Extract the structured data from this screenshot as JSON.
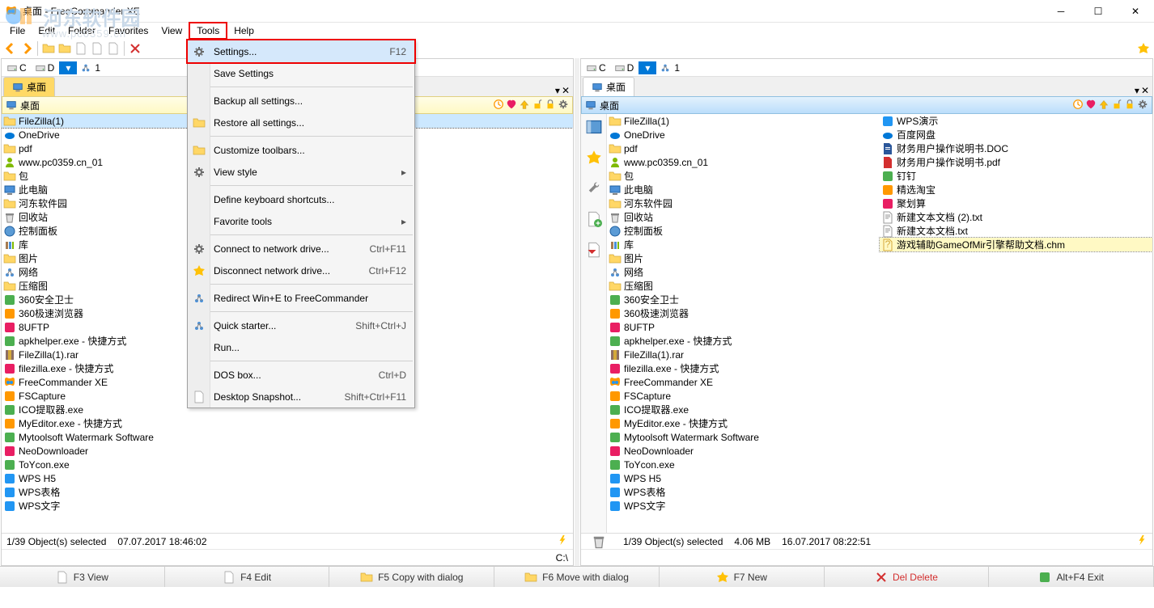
{
  "title": "桌面 - FreeCommander XE",
  "watermark": {
    "text": "河东软件园",
    "sub": "www.pc0359.cn"
  },
  "menubar": [
    "File",
    "Edit",
    "Folder",
    "Favorites",
    "View",
    "Tools",
    "Help"
  ],
  "menubar_highlight_index": 5,
  "dropdown": {
    "groups": [
      [
        {
          "label": "Settings...",
          "shortcut": "F12",
          "highlighted": true
        },
        {
          "label": "Save Settings"
        }
      ],
      [
        {
          "label": "Backup all settings..."
        },
        {
          "label": "Restore all settings..."
        }
      ],
      [
        {
          "label": "Customize toolbars..."
        },
        {
          "label": "View style",
          "submenu": true
        }
      ],
      [
        {
          "label": "Define keyboard shortcuts..."
        },
        {
          "label": "Favorite tools",
          "submenu": true
        }
      ],
      [
        {
          "label": "Connect to network drive...",
          "shortcut": "Ctrl+F11"
        },
        {
          "label": "Disconnect network drive...",
          "shortcut": "Ctrl+F12"
        }
      ],
      [
        {
          "label": "Redirect Win+E to FreeCommander"
        }
      ],
      [
        {
          "label": "Quick starter...",
          "shortcut": "Shift+Ctrl+J"
        },
        {
          "label": "Run..."
        }
      ],
      [
        {
          "label": "DOS box...",
          "shortcut": "Ctrl+D"
        },
        {
          "label": "Desktop Snapshot...",
          "shortcut": "Shift+Ctrl+F11"
        }
      ]
    ]
  },
  "drives": {
    "items": [
      "C",
      "D"
    ],
    "active_index": 1,
    "extra": "1"
  },
  "left": {
    "tab": "桌面",
    "tab_active": true,
    "path": "桌面",
    "status": {
      "selection": "1/39 Object(s) selected",
      "date": "07.07.2017 18:46:02"
    },
    "pathline": "C:\\",
    "files": [
      {
        "name": "FileZilla(1)",
        "type": "folder",
        "selected": "active"
      },
      {
        "name": "OneDrive",
        "type": "cloud"
      },
      {
        "name": "pdf",
        "type": "folder"
      },
      {
        "name": "www.pc0359.cn_01",
        "type": "user"
      },
      {
        "name": "包",
        "type": "folder"
      },
      {
        "name": "此电脑",
        "type": "computer"
      },
      {
        "name": "河东软件园",
        "type": "folder"
      },
      {
        "name": "回收站",
        "type": "recycle"
      },
      {
        "name": "控制面板",
        "type": "control"
      },
      {
        "name": "库",
        "type": "library"
      },
      {
        "name": "图片",
        "type": "folder"
      },
      {
        "name": "网络",
        "type": "network"
      },
      {
        "name": "压缩图",
        "type": "folder"
      },
      {
        "name": "360安全卫士",
        "type": "app360"
      },
      {
        "name": "360极速浏览器",
        "type": "app360b"
      },
      {
        "name": "8UFTP",
        "type": "appftp"
      },
      {
        "name": "apkhelper.exe - 快捷方式",
        "type": "appapk"
      },
      {
        "name": "FileZilla(1).rar",
        "type": "rar"
      },
      {
        "name": "filezilla.exe - 快捷方式",
        "type": "appfz"
      },
      {
        "name": "FreeCommander XE",
        "type": "appfc"
      },
      {
        "name": "FSCapture",
        "type": "appfs"
      },
      {
        "name": "ICO提取器.exe",
        "type": "appico"
      },
      {
        "name": "MyEditor.exe - 快捷方式",
        "type": "appme"
      },
      {
        "name": "Mytoolsoft Watermark Software",
        "type": "appwm"
      },
      {
        "name": "NeoDownloader",
        "type": "appnd"
      },
      {
        "name": "ToYcon.exe",
        "type": "appty"
      },
      {
        "name": "WPS H5",
        "type": "wps"
      },
      {
        "name": "WPS表格",
        "type": "wps"
      },
      {
        "name": "WPS文字",
        "type": "wps"
      }
    ]
  },
  "right": {
    "tab": "桌面",
    "path": "桌面",
    "status": {
      "selection": "1/39 Object(s) selected",
      "size": "4.06 MB",
      "date": "16.07.2017 08:22:51"
    },
    "col1": [
      {
        "name": "FileZilla(1)",
        "type": "folder"
      },
      {
        "name": "OneDrive",
        "type": "cloud"
      },
      {
        "name": "pdf",
        "type": "folder"
      },
      {
        "name": "www.pc0359.cn_01",
        "type": "user"
      },
      {
        "name": "包",
        "type": "folder"
      },
      {
        "name": "此电脑",
        "type": "computer"
      },
      {
        "name": "河东软件园",
        "type": "folder"
      },
      {
        "name": "回收站",
        "type": "recycle"
      },
      {
        "name": "控制面板",
        "type": "control"
      },
      {
        "name": "库",
        "type": "library"
      },
      {
        "name": "图片",
        "type": "folder"
      },
      {
        "name": "网络",
        "type": "network"
      },
      {
        "name": "压缩图",
        "type": "folder"
      },
      {
        "name": "360安全卫士",
        "type": "app360"
      },
      {
        "name": "360极速浏览器",
        "type": "app360b"
      },
      {
        "name": "8UFTP",
        "type": "appftp"
      },
      {
        "name": "apkhelper.exe - 快捷方式",
        "type": "appapk"
      },
      {
        "name": "FileZilla(1).rar",
        "type": "rar"
      },
      {
        "name": "filezilla.exe - 快捷方式",
        "type": "appfz"
      },
      {
        "name": "FreeCommander XE",
        "type": "appfc"
      },
      {
        "name": "FSCapture",
        "type": "appfs"
      },
      {
        "name": "ICO提取器.exe",
        "type": "appico"
      },
      {
        "name": "MyEditor.exe - 快捷方式",
        "type": "appme"
      },
      {
        "name": "Mytoolsoft Watermark Software",
        "type": "appwm"
      },
      {
        "name": "NeoDownloader",
        "type": "appnd"
      },
      {
        "name": "ToYcon.exe",
        "type": "appty"
      },
      {
        "name": "WPS H5",
        "type": "wps"
      },
      {
        "name": "WPS表格",
        "type": "wps"
      },
      {
        "name": "WPS文字",
        "type": "wps"
      }
    ],
    "col2": [
      {
        "name": "WPS演示",
        "type": "wps"
      },
      {
        "name": "百度网盘",
        "type": "baidu"
      },
      {
        "name": "财务用户操作说明书.DOC",
        "type": "doc"
      },
      {
        "name": "财务用户操作说明书.pdf",
        "type": "pdf"
      },
      {
        "name": "钉钉",
        "type": "ding"
      },
      {
        "name": "精选淘宝",
        "type": "tb"
      },
      {
        "name": "聚划算",
        "type": "ju"
      },
      {
        "name": "新建文本文档 (2).txt",
        "type": "txt"
      },
      {
        "name": "新建文本文档.txt",
        "type": "txt"
      },
      {
        "name": "游戏辅助GameOfMir引擎帮助文档.chm",
        "type": "chm",
        "selected": "inactive"
      }
    ]
  },
  "fkeys": [
    {
      "label": "F3 View"
    },
    {
      "label": "F4 Edit"
    },
    {
      "label": "F5 Copy with dialog"
    },
    {
      "label": "F6 Move with dialog"
    },
    {
      "label": "F7 New"
    },
    {
      "label": "Del Delete",
      "red": true
    },
    {
      "label": "Alt+F4 Exit"
    }
  ]
}
